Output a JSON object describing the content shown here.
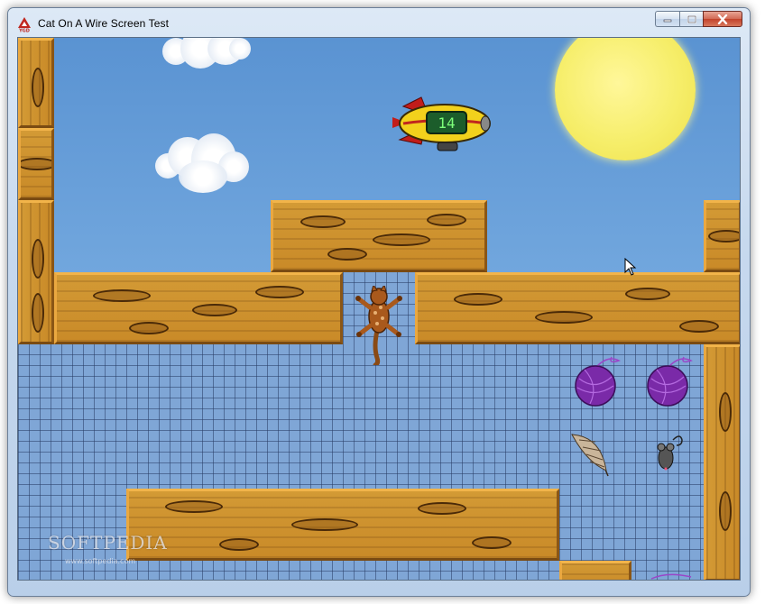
{
  "window": {
    "title": "Cat On A Wire Screen Test",
    "colors": {
      "titlebar": "#c7d9ee",
      "close_button": "#c2432b"
    }
  },
  "game": {
    "blimp_display": "14",
    "watermark": "SOFTPEDIA",
    "watermark_url": "www.softpedia.com",
    "colors": {
      "sky": "#6aa2dc",
      "wood": "#c98a28",
      "mesh": "#7fa6d6",
      "sun": "#f6ee6a",
      "yarn": "#7a2aa8"
    },
    "icons": [
      "cat-icon",
      "blimp-icon",
      "yarn-ball-icon",
      "feather-icon",
      "mouse-toy-icon",
      "sun-icon",
      "cloud-icon",
      "cursor-icon"
    ]
  }
}
